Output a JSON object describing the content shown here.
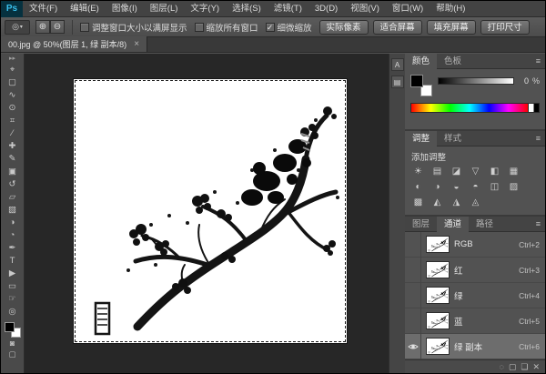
{
  "app": {
    "logo": "Ps"
  },
  "ui": {
    "close_glyph": "×",
    "panel_menu_glyph": "≡",
    "toolbar_collapse_glyph": "▸▸",
    "check_glyph": "✓",
    "zoom_in_glyph": "⊕",
    "zoom_out_glyph": "⊖",
    "tool_preview_glyph": "◎",
    "dropdown_glyph": "▾"
  },
  "menubar": {
    "items": [
      {
        "label": "文件(F)"
      },
      {
        "label": "编辑(E)"
      },
      {
        "label": "图像(I)"
      },
      {
        "label": "图层(L)"
      },
      {
        "label": "文字(Y)"
      },
      {
        "label": "选择(S)"
      },
      {
        "label": "滤镜(T)"
      },
      {
        "label": "3D(D)"
      },
      {
        "label": "视图(V)"
      },
      {
        "label": "窗口(W)"
      },
      {
        "label": "帮助(H)"
      }
    ]
  },
  "options": {
    "checkboxes": [
      {
        "label": "调整窗口大小以满屏显示",
        "checked": false
      },
      {
        "label": "缩放所有窗口",
        "checked": false
      },
      {
        "label": "细微缩放",
        "checked": true
      }
    ],
    "buttons": [
      {
        "label": "实际像素",
        "name": "actual-pixels-button"
      },
      {
        "label": "适合屏幕",
        "name": "fit-screen-button"
      },
      {
        "label": "填充屏幕",
        "name": "fill-screen-button"
      },
      {
        "label": "打印尺寸",
        "name": "print-size-button"
      }
    ]
  },
  "document": {
    "tab_title": "00.jpg @ 50%(图层 1, 绿 副本/8)"
  },
  "toolbar": {
    "tools": [
      {
        "name": "move-tool-icon",
        "glyph": "⌖"
      },
      {
        "name": "marquee-tool-icon",
        "glyph": "▢"
      },
      {
        "name": "lasso-tool-icon",
        "glyph": "∿"
      },
      {
        "name": "quick-select-tool-icon",
        "glyph": "⊙"
      },
      {
        "name": "crop-tool-icon",
        "glyph": "⌗"
      },
      {
        "name": "eyedropper-tool-icon",
        "glyph": "∕"
      },
      {
        "name": "healing-tool-icon",
        "glyph": "✚"
      },
      {
        "name": "brush-tool-icon",
        "glyph": "✎"
      },
      {
        "name": "clone-stamp-tool-icon",
        "glyph": "▣"
      },
      {
        "name": "history-brush-tool-icon",
        "glyph": "↺"
      },
      {
        "name": "eraser-tool-icon",
        "glyph": "▱"
      },
      {
        "name": "gradient-tool-icon",
        "glyph": "▧"
      },
      {
        "name": "blur-tool-icon",
        "glyph": "◑"
      },
      {
        "name": "dodge-tool-icon",
        "glyph": "◔"
      },
      {
        "name": "pen-tool-icon",
        "glyph": "✒"
      },
      {
        "name": "type-tool-icon",
        "glyph": "T"
      },
      {
        "name": "path-select-tool-icon",
        "glyph": "▶"
      },
      {
        "name": "shape-tool-icon",
        "glyph": "▭"
      },
      {
        "name": "hand-tool-icon",
        "glyph": "☞"
      },
      {
        "name": "zoom-tool-icon",
        "glyph": "◎"
      }
    ]
  },
  "dock": {
    "icons": [
      {
        "name": "character-panel-icon",
        "glyph": "A"
      },
      {
        "name": "properties-panel-icon",
        "glyph": "▤"
      }
    ]
  },
  "panels": {
    "color": {
      "tabs": [
        {
          "label": "颜色",
          "active": true
        },
        {
          "label": "色板",
          "active": false
        }
      ],
      "value": "0",
      "unit": "%"
    },
    "adjustments": {
      "tabs": [
        {
          "label": "调整",
          "active": true
        },
        {
          "label": "样式",
          "active": false
        }
      ],
      "add_label": "添加调整",
      "icons": [
        {
          "name": "brightness-contrast-icon",
          "glyph": "☀"
        },
        {
          "name": "levels-icon",
          "glyph": "▤"
        },
        {
          "name": "curves-icon",
          "glyph": "◪"
        },
        {
          "name": "exposure-icon",
          "glyph": "▽"
        },
        {
          "name": "vibrance-icon",
          "glyph": "◧"
        },
        {
          "name": "hue-saturation-icon",
          "glyph": "▦"
        },
        {
          "name": "color-balance-icon",
          "glyph": "◐"
        },
        {
          "name": "black-white-icon",
          "glyph": "◑"
        },
        {
          "name": "photo-filter-icon",
          "glyph": "◒"
        },
        {
          "name": "channel-mixer-icon",
          "glyph": "◓"
        },
        {
          "name": "color-lookup-icon",
          "glyph": "◫"
        },
        {
          "name": "invert-icon",
          "glyph": "▨"
        },
        {
          "name": "posterize-icon",
          "glyph": "▩"
        },
        {
          "name": "threshold-icon",
          "glyph": "◭"
        },
        {
          "name": "gradient-map-icon",
          "glyph": "◮"
        },
        {
          "name": "selective-color-icon",
          "glyph": "◬"
        }
      ]
    },
    "channels": {
      "tabs": [
        {
          "label": "图层",
          "active": false
        },
        {
          "label": "通道",
          "active": true
        },
        {
          "label": "路径",
          "active": false
        }
      ],
      "rows": [
        {
          "name": "RGB",
          "shortcut": "Ctrl+2",
          "visible": false,
          "selected": false
        },
        {
          "name": "红",
          "shortcut": "Ctrl+3",
          "visible": false,
          "selected": false
        },
        {
          "name": "绿",
          "shortcut": "Ctrl+4",
          "visible": false,
          "selected": false
        },
        {
          "name": "蓝",
          "shortcut": "Ctrl+5",
          "visible": false,
          "selected": false
        },
        {
          "name": "绿 副本",
          "shortcut": "Ctrl+6",
          "visible": true,
          "selected": true
        }
      ],
      "bottom_icons": [
        {
          "name": "load-selection-icon",
          "glyph": "◌"
        },
        {
          "name": "save-selection-icon",
          "glyph": "▢"
        },
        {
          "name": "new-channel-icon",
          "glyph": "❏"
        },
        {
          "name": "delete-channel-icon",
          "glyph": "✕"
        }
      ]
    }
  }
}
